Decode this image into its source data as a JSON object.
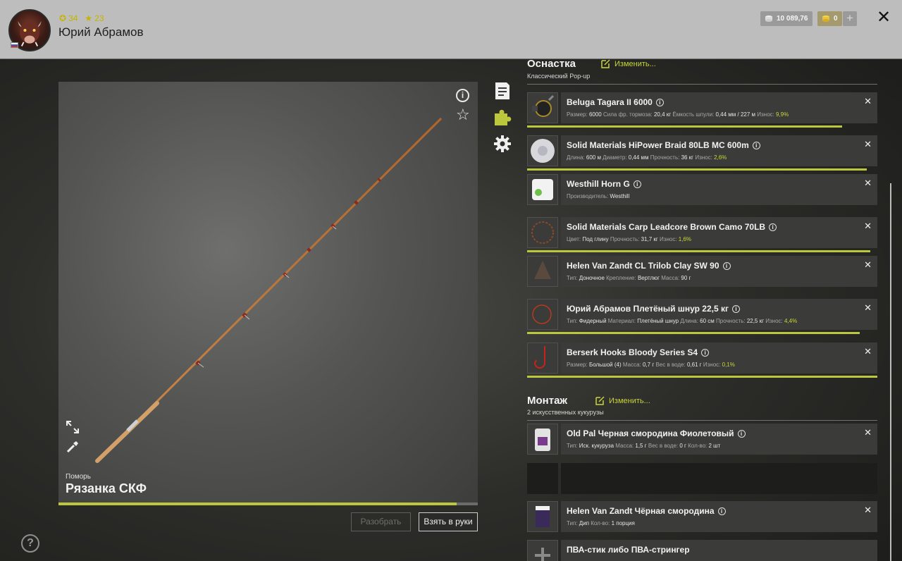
{
  "header": {
    "user_name": "Юрий Абрамов",
    "level": "34",
    "rating": "23",
    "silver": "10 089,76",
    "gold": "0",
    "plus": "+",
    "close": "✕"
  },
  "rod": {
    "brand": "Поморь",
    "name": "Рязанка СКФ",
    "condition_percent": 95
  },
  "buttons": {
    "disassemble": "Разобрать",
    "take": "Взять в руки"
  },
  "help": "?",
  "tackle": {
    "title": "Оснастка",
    "edit": "Изменить...",
    "subtitle": "Классический Pop-up",
    "items": [
      {
        "name": "Beluga Tagara II 6000",
        "props": [
          [
            "Размер:",
            "6000"
          ],
          [
            "Сила фр. тормоза:",
            "20,4 кг"
          ],
          [
            "Ёмкость шпули:",
            "0,44 мм / 227 м"
          ],
          [
            "Износ:",
            "9,9%"
          ]
        ],
        "bar": 90
      },
      {
        "name": "Solid Materials HiPower Braid 80LB MC 600m",
        "props": [
          [
            "Длина:",
            "600 м"
          ],
          [
            "Диаметр:",
            "0,44 мм"
          ],
          [
            "Прочность:",
            "36 кг"
          ],
          [
            "Износ:",
            "2,6%"
          ]
        ],
        "bar": 97
      },
      {
        "name": "Westhill Horn G",
        "props": [
          [
            "Производитель:",
            "Westhill"
          ]
        ],
        "bar": 0
      },
      {
        "name": "Solid Materials Carp Leadcore Brown Camo 70LB",
        "props": [
          [
            "Цвет:",
            "Под глину"
          ],
          [
            "Прочность:",
            "31,7 кг"
          ],
          [
            "Износ:",
            "1,6%"
          ]
        ],
        "bar": 98
      },
      {
        "name": "Helen Van Zandt CL Trilob Clay SW 90",
        "props": [
          [
            "Тип:",
            "Доночное"
          ],
          [
            "Крепление:",
            "Вертлюг"
          ],
          [
            "Масса:",
            "90 г"
          ]
        ],
        "bar": 0
      },
      {
        "name": "Юрий Абрамов Плетёный шнур 22,5 кг",
        "props": [
          [
            "Тип:",
            "Фидерный"
          ],
          [
            "Материал:",
            "Плетёный шнур"
          ],
          [
            "Длина:",
            "60 см"
          ],
          [
            "Прочность:",
            "22,5 кг"
          ],
          [
            "Износ:",
            "4,4%"
          ]
        ],
        "bar": 95
      },
      {
        "name": "Berserk Hooks Bloody Series S4",
        "props": [
          [
            "Размер:",
            "Большой (4)"
          ],
          [
            "Масса:",
            "0,7 г"
          ],
          [
            "Вес в воде:",
            "0,61 г"
          ],
          [
            "Износ:",
            "0,1%"
          ]
        ],
        "bar": 100
      }
    ]
  },
  "montage": {
    "title": "Монтаж",
    "edit": "Изменить...",
    "subtitle": "2 искусственных кукурузы",
    "items": [
      {
        "name": "Old Pal Черная смородина Фиолетовый",
        "props": [
          [
            "Тип:",
            "Иск. кукуруза"
          ],
          [
            "Масса:",
            "1,5 г"
          ],
          [
            "Вес в воде:",
            "0 г"
          ],
          [
            "Кол-во:",
            "2 шт"
          ]
        ]
      },
      {
        "name": "Helen Van Zandt Чёрная смородина",
        "props": [
          [
            "Тип:",
            "Дип"
          ],
          [
            "Кол-во:",
            "1 порция"
          ]
        ]
      },
      {
        "name": "ПВА-стик либо ПВА-стрингер",
        "props": []
      }
    ]
  },
  "colors": {
    "accent": "#bcc73d",
    "bar_bg": "#6b6b6b"
  }
}
